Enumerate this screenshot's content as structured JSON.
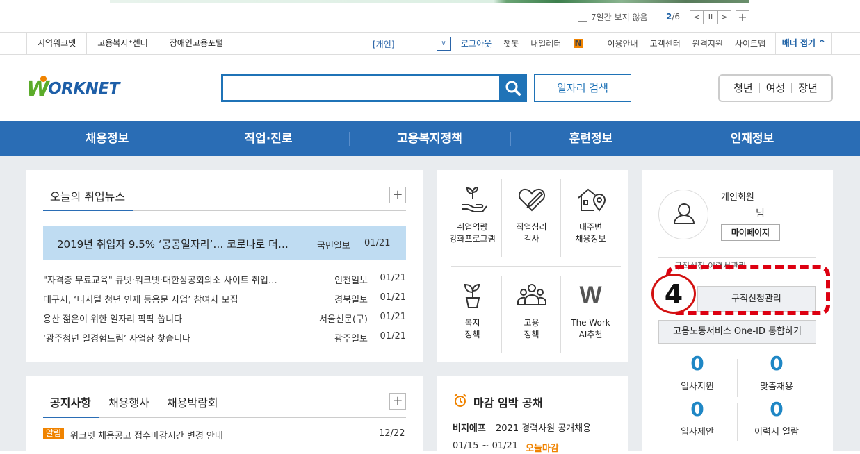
{
  "banner": {
    "hide_week_label": "7일간 보지 않음",
    "page_current": "2",
    "page_total": "/6",
    "prev": "<",
    "pause": "II",
    "next": ">",
    "add": "+"
  },
  "util": {
    "left": [
      "지역워크넷",
      "고용복지⁺센터",
      "장애인고용포털"
    ],
    "mode": "[개인]",
    "right": [
      "로그아웃",
      "챗봇",
      "내일레터",
      "이용안내",
      "고객센터",
      "원격지원",
      "사이트맵"
    ],
    "new_badge": "N",
    "fold": "배너 접기 ^"
  },
  "header": {
    "logo_w": "W",
    "logo_rest": "ORKNET",
    "search_placeholder": "",
    "job_search_label": "일자리 검색",
    "quick": [
      "청년",
      "여성",
      "장년"
    ]
  },
  "gnb": [
    "채용정보",
    "직업·진로",
    "고용복지정책",
    "훈련정보",
    "인재정보"
  ],
  "news": {
    "title": "오늘의 취업뉴스",
    "headline": {
      "title": "2019년 취업자 9.5% ‘공공일자리’… 코로나로 더…",
      "source": "국민일보",
      "date": "01/21"
    },
    "items": [
      {
        "title": "\"자격증 무료교육\" 큐넷·워크넷·대한상공회의소 사이트 취업…",
        "source": "인천일보",
        "date": "01/21"
      },
      {
        "title": "대구시, ‘디지털 청년 인재 등용문 사업’ 참여자 모집",
        "source": "경북일보",
        "date": "01/21"
      },
      {
        "title": "용산 젊은이 위한 일자리 팍팍 쏩니다",
        "source": "서울신문(구)",
        "date": "01/21"
      },
      {
        "title": "‘광주청년 일경험드림’ 사업장 찾습니다",
        "source": "광주일보",
        "date": "01/21"
      }
    ]
  },
  "services": [
    {
      "icon": "hand-sprout-icon",
      "line1": "취업역량",
      "line2": "강화프로그램"
    },
    {
      "icon": "heart-pen-icon",
      "line1": "직업심리",
      "line2": "검사"
    },
    {
      "icon": "house-location-icon",
      "line1": "내주변",
      "line2": "채용정보"
    },
    {
      "icon": "plant-pot-icon",
      "line1": "복지",
      "line2": "정책"
    },
    {
      "icon": "people-group-icon",
      "line1": "고용",
      "line2": "정책"
    },
    {
      "icon": "the-work-logo-icon",
      "logo_letter": "W",
      "line1": "The Work",
      "line2": "AI추천"
    }
  ],
  "member": {
    "type": "개인회원",
    "nim": "님",
    "mypage": "마이페이지",
    "hidden_row": "구직신청  이력서관리",
    "apply_manage": "구직신청관리",
    "oneid": "고용노동서비스 One-ID 통합하기",
    "stats": [
      {
        "num": "0",
        "label": "입사지원"
      },
      {
        "num": "0",
        "label": "맞춤채용"
      },
      {
        "num": "0",
        "label": "입사제안"
      },
      {
        "num": "0",
        "label": "이력서 열람"
      }
    ]
  },
  "annotation": {
    "step": "4"
  },
  "notice": {
    "tabs": [
      "공지사항",
      "채용행사",
      "채용박람회"
    ],
    "badge": "알림",
    "item": {
      "title": "워크넷 채용공고 접수마감시간 변경 안내",
      "date": "12/22"
    }
  },
  "deadline": {
    "title": "마감 임박 공채",
    "company": "비지에프",
    "job": "2021 경력사원 공개채용",
    "period": "01/15 ~ 01/21",
    "status": "오늘마감"
  },
  "colors": {
    "primary": "#2a6db5",
    "accent": "#f08300",
    "stat": "#1f87c5",
    "annotation": "#dd0011"
  }
}
